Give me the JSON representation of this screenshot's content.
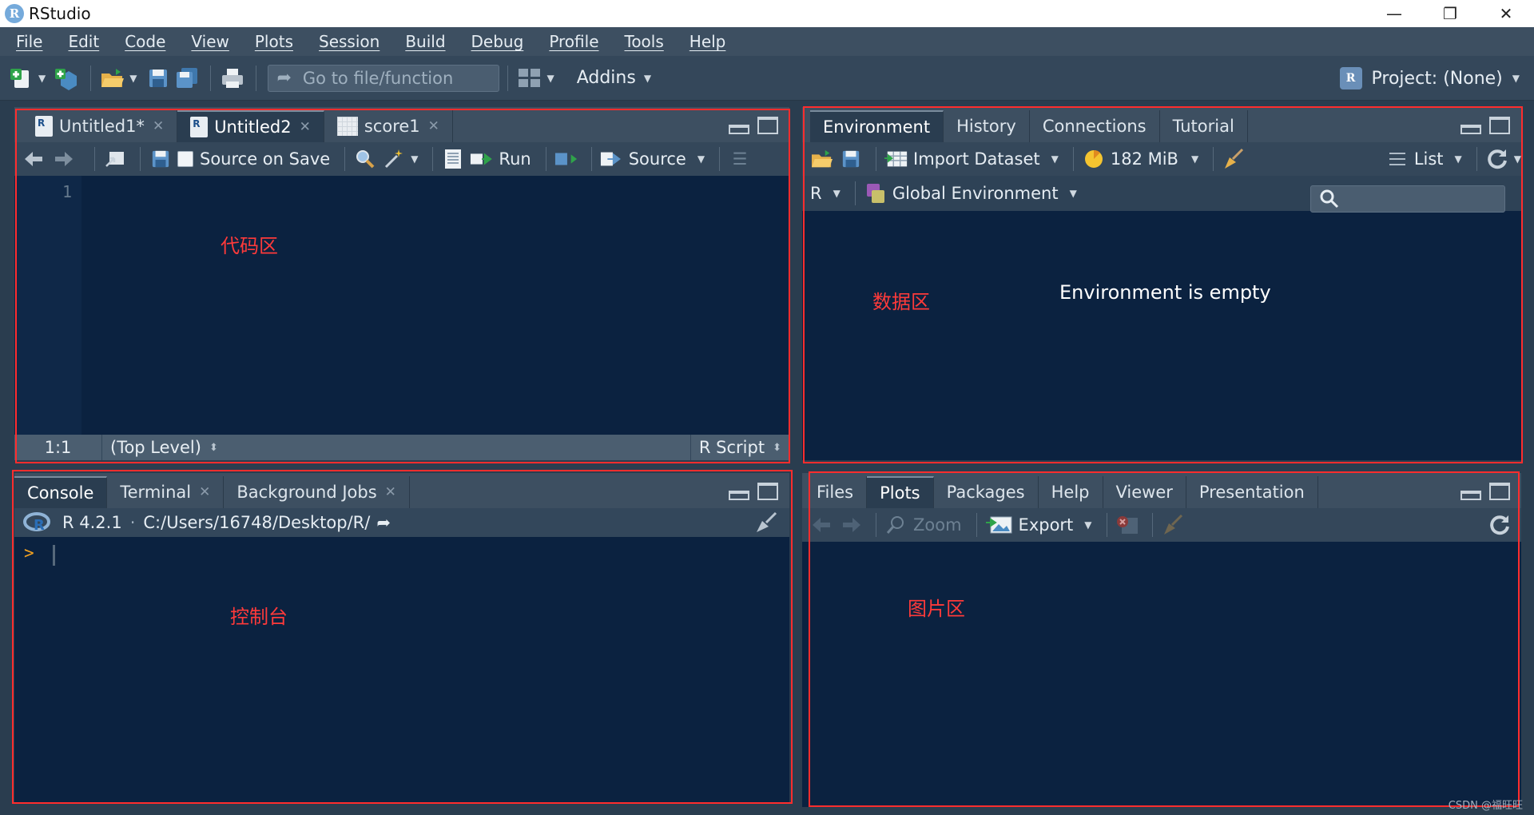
{
  "window": {
    "title": "RStudio",
    "controls": [
      "—",
      "❐",
      "✕"
    ]
  },
  "menu": [
    "File",
    "Edit",
    "Code",
    "View",
    "Plots",
    "Session",
    "Build",
    "Debug",
    "Profile",
    "Tools",
    "Help"
  ],
  "toolbar": {
    "goto_placeholder": "Go to file/function",
    "addins": "Addins",
    "project": "Project: (None)"
  },
  "source_pane": {
    "tabs": [
      {
        "label": "Untitled1*",
        "icon": "r-document-icon"
      },
      {
        "label": "Untitled2",
        "icon": "r-document-icon",
        "active": true
      },
      {
        "label": "score1",
        "icon": "data-grid-icon"
      }
    ],
    "source_on_save": "Source on Save",
    "run": "Run",
    "source": "Source",
    "line_numbers": [
      "1"
    ],
    "status": {
      "position": "1:1",
      "scope": "(Top Level)",
      "file_type": "R Script"
    },
    "annotation": "代码区"
  },
  "environment_pane": {
    "tabs": [
      "Environment",
      "History",
      "Connections",
      "Tutorial"
    ],
    "import_dataset": "Import Dataset",
    "memory": "182 MiB",
    "view_mode": "List",
    "language": "R",
    "scope": "Global Environment",
    "empty_message": "Environment is empty",
    "annotation": "数据区"
  },
  "console_pane": {
    "tabs": [
      "Console",
      "Terminal",
      "Background Jobs"
    ],
    "r_version": "R 4.2.1",
    "separator": "·",
    "working_dir": "C:/Users/16748/Desktop/R/",
    "prompt": ">",
    "annotation": "控制台"
  },
  "files_pane": {
    "tabs": [
      "Files",
      "Plots",
      "Packages",
      "Help",
      "Viewer",
      "Presentation"
    ],
    "zoom": "Zoom",
    "export": "Export",
    "annotation": "图片区"
  },
  "watermark": "CSDN @福旺旺",
  "colors": {
    "pane_bg": "#0b2240",
    "chrome": "#3d4f61",
    "annotation_red": "#ff2d2d",
    "prompt": "#f0a020"
  }
}
